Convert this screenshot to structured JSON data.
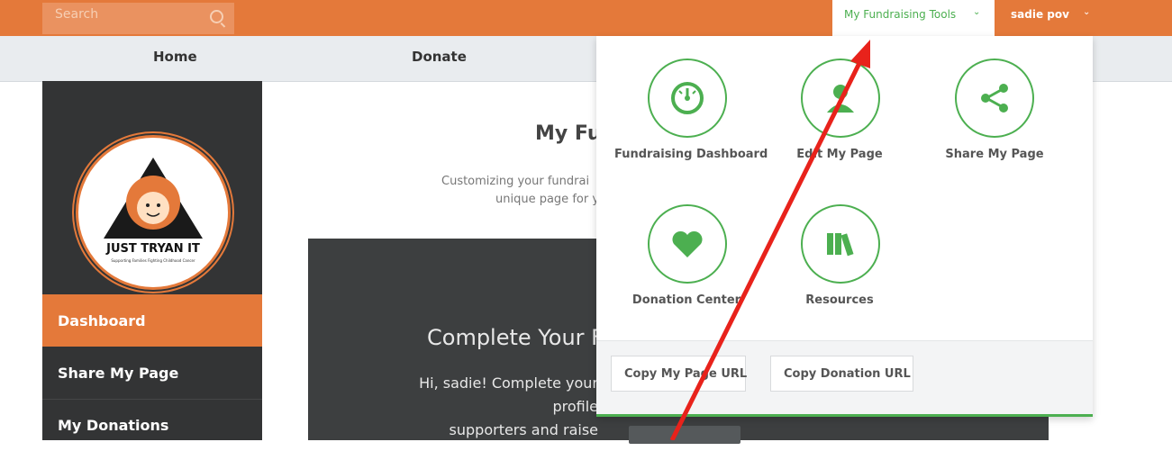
{
  "header": {
    "search_placeholder": "Search",
    "tools_label": "My Fundraising Tools",
    "user_label": "sadie pov",
    "chevron": "⌄"
  },
  "nav": {
    "home": "Home",
    "donate": "Donate"
  },
  "sidebar": {
    "logo_text": "JUST TRYAN IT",
    "logo_sub": "Supporting Families Fighting Childhood Cancer",
    "items": [
      {
        "label": "Dashboard",
        "active": true
      },
      {
        "label": "Share My Page",
        "active": false
      },
      {
        "label": "My Donations",
        "active": false
      }
    ]
  },
  "main": {
    "title": "My Fu",
    "desc_line1": "Customizing your fundrai",
    "desc_line2": "unique page for y",
    "banner_title": "Complete Your F",
    "banner_text_line1": "Hi, sadie! Complete your profile",
    "banner_text_line2": "supporters and raise"
  },
  "dropdown": {
    "tools": [
      {
        "label": "Fundraising Dashboard",
        "icon": "gauge-icon"
      },
      {
        "label": "Edit My Page",
        "icon": "user-icon"
      },
      {
        "label": "Share My Page",
        "icon": "share-icon"
      },
      {
        "label": "Donation Center",
        "icon": "heart-icon"
      },
      {
        "label": "Resources",
        "icon": "books-icon"
      }
    ],
    "copy_page_url": "Copy My Page URL",
    "copy_donation_url": "Copy Donation URL"
  },
  "colors": {
    "brand_orange": "#e4793a",
    "accent_green": "#4caf50",
    "sidebar_dark": "#333435",
    "annotation_red": "#e8221b"
  }
}
